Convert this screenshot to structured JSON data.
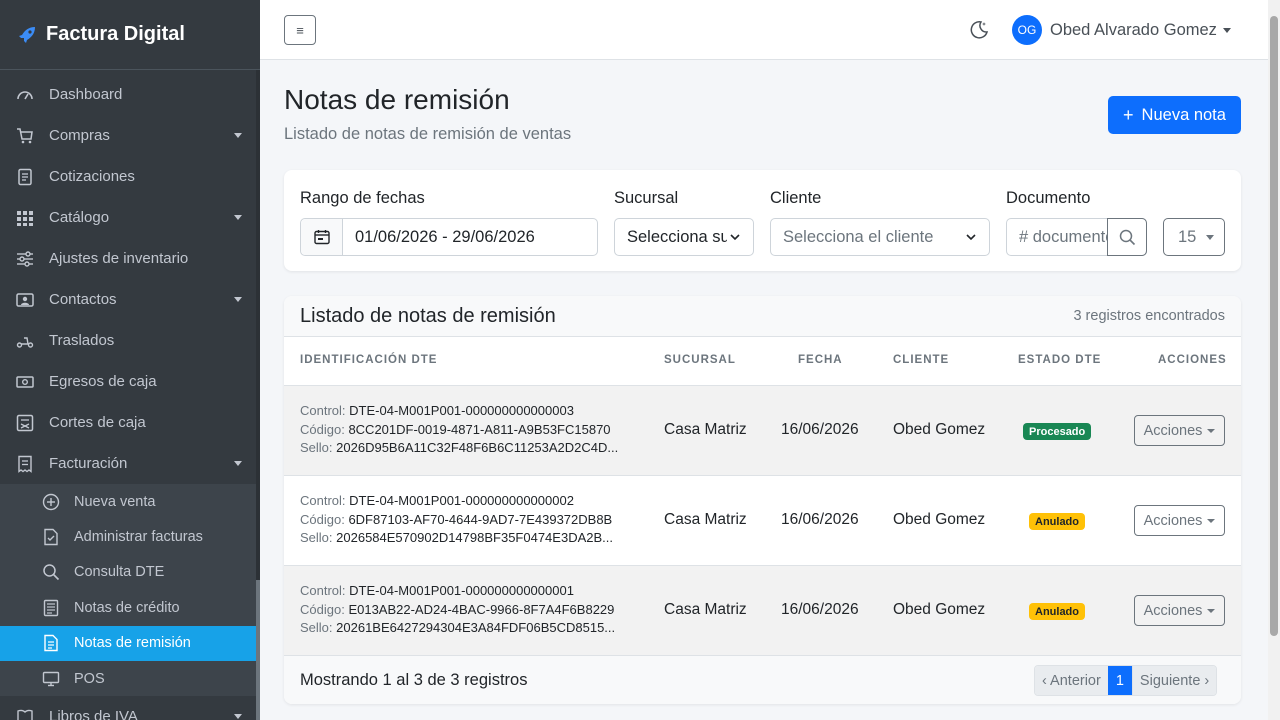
{
  "brand": {
    "title": "Factura Digital"
  },
  "sidebar": {
    "items": [
      {
        "label": "Dashboard",
        "icon": "gauge-icon"
      },
      {
        "label": "Compras",
        "icon": "cart-icon"
      },
      {
        "label": "Cotizaciones",
        "icon": "document-icon"
      },
      {
        "label": "Catálogo",
        "icon": "grid-icon"
      },
      {
        "label": "Ajustes de inventario",
        "icon": "sliders-icon"
      },
      {
        "label": "Contactos",
        "icon": "contact-card-icon"
      },
      {
        "label": "Traslados",
        "icon": "scooter-icon"
      },
      {
        "label": "Egresos de caja",
        "icon": "cash-icon"
      },
      {
        "label": "Cortes de caja",
        "icon": "calculator-icon"
      },
      {
        "label": "Facturación",
        "icon": "receipt-icon"
      }
    ],
    "sub_items": [
      {
        "label": "Nueva venta",
        "icon": "plus-circle-icon"
      },
      {
        "label": "Administrar facturas",
        "icon": "file-check-icon"
      },
      {
        "label": "Consulta DTE",
        "icon": "search-icon"
      },
      {
        "label": "Notas de crédito",
        "icon": "note-icon"
      },
      {
        "label": "Notas de remisión",
        "icon": "file-receipt-icon"
      },
      {
        "label": "POS",
        "icon": "monitor-icon"
      }
    ],
    "last_item": {
      "label": "Libros de IVA",
      "icon": "book-icon"
    }
  },
  "topbar": {
    "user_initials": "OG",
    "user_name": "Obed Alvarado Gomez"
  },
  "header": {
    "title": "Notas de remisión",
    "subtitle": "Listado de notas de remisión de ventas",
    "new_button": "Nueva nota",
    "new_button_plus": "+"
  },
  "filters": {
    "date_label": "Rango de fechas",
    "date_value": "01/06/2026 - 29/06/2026",
    "branch_label": "Sucursal",
    "branch_value": "Selecciona sucursal",
    "client_label": "Cliente",
    "client_placeholder": "Selecciona el cliente",
    "doc_label": "Documento",
    "doc_placeholder": "# documento",
    "per_page": "15"
  },
  "list": {
    "title": "Listado de notas de remisión",
    "count": "3 registros encontrados",
    "columns": [
      "IDENTIFICACIÓN DTE",
      "SUCURSAL",
      "FECHA",
      "CLIENTE",
      "ESTADO DTE",
      "ACCIONES"
    ],
    "field_labels": {
      "control": "Control:",
      "codigo": "Código:",
      "sello": "Sello:"
    },
    "rows": [
      {
        "control": "DTE-04-M001P001-000000000000003",
        "codigo": "8CC201DF-0019-4871-A811-A9B53FC15870",
        "sello": "2026D95B6A11C32F48F6B6C11253A2D2C4D...",
        "sucursal": "Casa Matriz",
        "fecha": "16/06/2026",
        "cliente": "Obed Gomez",
        "estado": "Procesado",
        "accion": "Acciones"
      },
      {
        "control": "DTE-04-M001P001-000000000000002",
        "codigo": "6DF87103-AF70-4644-9AD7-7E439372DB8B",
        "sello": "2026584E570902D14798BF35F0474E3DA2B...",
        "sucursal": "Casa Matriz",
        "fecha": "16/06/2026",
        "cliente": "Obed Gomez",
        "estado": "Anulado",
        "accion": "Acciones"
      },
      {
        "control": "DTE-04-M001P001-000000000000001",
        "codigo": "E013AB22-AD24-4BAC-9966-8F7A4F6B8229",
        "sello": "20261BE6427294304E3A84FDF06B5CD8515...",
        "sucursal": "Casa Matriz",
        "fecha": "16/06/2026",
        "cliente": "Obed Gomez",
        "estado": "Anulado",
        "accion": "Acciones"
      }
    ],
    "footer": {
      "showing": "Mostrando 1 al 3 de 3 registros",
      "prev": "‹ Anterior",
      "current": "1",
      "next": "Siguiente ›"
    }
  },
  "colors": {
    "sidebar": "#343a40",
    "active": "#17a2e8",
    "primary": "#0d6efd",
    "success": "#198754",
    "warning": "#ffc107"
  }
}
